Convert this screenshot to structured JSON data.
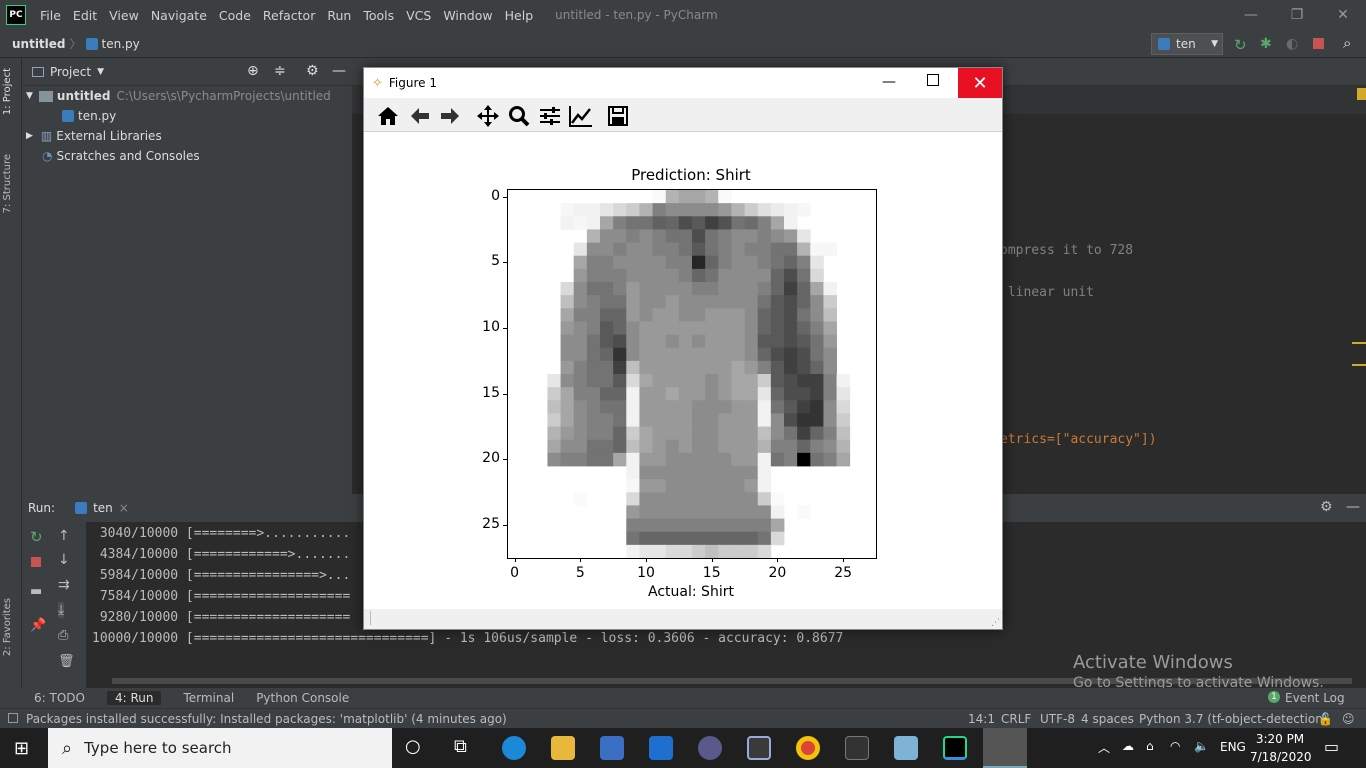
{
  "window": {
    "title": "untitled - ten.py - PyCharm",
    "logo": "PC"
  },
  "menu": [
    "File",
    "Edit",
    "View",
    "Navigate",
    "Code",
    "Refactor",
    "Run",
    "Tools",
    "VCS",
    "Window",
    "Help"
  ],
  "breadcrumb": {
    "project": "untitled",
    "file": "ten.py"
  },
  "run_config": "ten",
  "left_strip": {
    "project_tab": "1: Project",
    "structure_tab": "7: Structure",
    "favorites_tab": "2: Favorites"
  },
  "project_panel": {
    "title": "Project",
    "tree": [
      {
        "label": "untitled",
        "path": "C:\\Users\\s\\PycharmProjects\\untitled"
      },
      {
        "label": "ten.py"
      },
      {
        "label": "External Libraries"
      },
      {
        "label": "Scratches and Consoles"
      }
    ]
  },
  "editor_lines": [
    {
      "text": "ompress it to 728"
    },
    {
      "text": " linear unit"
    },
    {
      "text": "etrics=[\"accuracy\"])"
    }
  ],
  "run_panel": {
    "label": "Run:",
    "tab": "ten",
    "output": [
      " 3040/10000 [========>...........",
      " 4384/10000 [============>.......",
      " 5984/10000 [================>...",
      " 7584/10000 [====================",
      " 9280/10000 [====================",
      "10000/10000 [==============================] - 1s 106us/sample - loss: 0.3606 - accuracy: 0.8677"
    ]
  },
  "bottom_tabs": [
    "6: TODO",
    "4: Run",
    "Terminal",
    "Python Console"
  ],
  "event_log": {
    "badge": "1",
    "label": "Event Log"
  },
  "status": {
    "message": "Packages installed successfully: Installed packages: 'matplotlib' (4 minutes ago)",
    "position": "14:1",
    "line_sep": "CRLF",
    "encoding": "UTF-8",
    "indent": "4 spaces",
    "interpreter": "Python 3.7 (tf-object-detection)"
  },
  "activate": {
    "line1": "Activate Windows",
    "line2": "Go to Settings to activate Windows."
  },
  "taskbar": {
    "search_placeholder": "Type here to search",
    "time": "3:20 PM",
    "date": "7/18/2020",
    "lang": "ENG"
  },
  "figure": {
    "title": "Figure 1",
    "toolbar": [
      "home-icon",
      "back-icon",
      "forward-icon",
      "pan-icon",
      "zoom-icon",
      "configure-icon",
      "edit-axis-icon",
      "save-icon"
    ]
  },
  "chart_data": {
    "type": "heatmap",
    "title": "Prediction: Shirt",
    "xlabel": "Actual: Shirt",
    "ylabel": "",
    "colormap": "gray_r",
    "xticks": [
      0,
      5,
      10,
      15,
      20,
      25
    ],
    "yticks": [
      0,
      5,
      10,
      15,
      20,
      25
    ],
    "xlim": [
      -0.5,
      27.5
    ],
    "ylim": [
      27.5,
      -0.5
    ],
    "values": [
      [
        0,
        0,
        0,
        0,
        0,
        0,
        0,
        0,
        0,
        0,
        0,
        0.02,
        0.3,
        0.35,
        0.35,
        0.3,
        0.02,
        0,
        0,
        0,
        0,
        0,
        0,
        0,
        0,
        0,
        0,
        0
      ],
      [
        0,
        0,
        0,
        0,
        0.03,
        0.05,
        0.05,
        0.1,
        0.15,
        0.2,
        0.3,
        0.5,
        0.45,
        0.45,
        0.45,
        0.45,
        0.4,
        0.3,
        0.2,
        0.12,
        0.08,
        0.05,
        0.03,
        0,
        0,
        0,
        0,
        0
      ],
      [
        0,
        0,
        0,
        0,
        0.05,
        0.03,
        0.05,
        0.35,
        0.5,
        0.55,
        0.55,
        0.62,
        0.6,
        0.7,
        0.65,
        0.75,
        0.68,
        0.55,
        0.58,
        0.5,
        0.35,
        0.05,
        0,
        0,
        0,
        0,
        0,
        0
      ],
      [
        0,
        0,
        0,
        0,
        0,
        0,
        0.3,
        0.45,
        0.45,
        0.5,
        0.45,
        0.5,
        0.55,
        0.55,
        0.7,
        0.55,
        0.5,
        0.45,
        0.45,
        0.5,
        0.45,
        0.4,
        0.1,
        0,
        0,
        0,
        0,
        0
      ],
      [
        0,
        0,
        0,
        0,
        0,
        0.1,
        0.45,
        0.45,
        0.5,
        0.45,
        0.45,
        0.5,
        0.5,
        0.55,
        0.65,
        0.55,
        0.5,
        0.45,
        0.5,
        0.5,
        0.55,
        0.55,
        0.3,
        0.03,
        0.03,
        0,
        0,
        0
      ],
      [
        0,
        0,
        0,
        0,
        0,
        0.35,
        0.5,
        0.5,
        0.45,
        0.45,
        0.45,
        0.45,
        0.5,
        0.5,
        0.85,
        0.6,
        0.5,
        0.45,
        0.45,
        0.5,
        0.55,
        0.6,
        0.5,
        0.1,
        0,
        0,
        0,
        0
      ],
      [
        0,
        0,
        0,
        0,
        0,
        0.4,
        0.5,
        0.5,
        0.5,
        0.45,
        0.45,
        0.45,
        0.45,
        0.5,
        0.6,
        0.55,
        0.45,
        0.45,
        0.45,
        0.45,
        0.6,
        0.7,
        0.55,
        0.15,
        0,
        0,
        0,
        0
      ],
      [
        0,
        0,
        0,
        0,
        0.15,
        0.45,
        0.55,
        0.55,
        0.5,
        0.4,
        0.45,
        0.45,
        0.45,
        0.45,
        0.5,
        0.5,
        0.45,
        0.45,
        0.45,
        0.5,
        0.6,
        0.75,
        0.6,
        0.35,
        0.05,
        0,
        0,
        0
      ],
      [
        0,
        0,
        0,
        0,
        0.25,
        0.45,
        0.5,
        0.55,
        0.55,
        0.4,
        0.45,
        0.45,
        0.4,
        0.45,
        0.45,
        0.45,
        0.45,
        0.45,
        0.45,
        0.55,
        0.65,
        0.7,
        0.6,
        0.45,
        0.2,
        0,
        0,
        0
      ],
      [
        0,
        0,
        0,
        0,
        0.35,
        0.5,
        0.5,
        0.6,
        0.6,
        0.4,
        0.45,
        0.4,
        0.4,
        0.45,
        0.45,
        0.4,
        0.4,
        0.4,
        0.45,
        0.6,
        0.65,
        0.7,
        0.55,
        0.45,
        0.25,
        0,
        0,
        0
      ],
      [
        0,
        0,
        0,
        0,
        0.4,
        0.45,
        0.5,
        0.65,
        0.6,
        0.45,
        0.4,
        0.4,
        0.4,
        0.4,
        0.4,
        0.4,
        0.4,
        0.4,
        0.45,
        0.6,
        0.65,
        0.7,
        0.6,
        0.5,
        0.35,
        0,
        0,
        0
      ],
      [
        0,
        0,
        0,
        0,
        0.45,
        0.45,
        0.55,
        0.65,
        0.7,
        0.45,
        0.4,
        0.4,
        0.45,
        0.4,
        0.45,
        0.4,
        0.4,
        0.4,
        0.45,
        0.65,
        0.65,
        0.7,
        0.65,
        0.55,
        0.4,
        0,
        0,
        0
      ],
      [
        0,
        0,
        0,
        0,
        0.45,
        0.45,
        0.55,
        0.6,
        0.8,
        0.45,
        0.4,
        0.4,
        0.4,
        0.4,
        0.4,
        0.4,
        0.4,
        0.4,
        0.45,
        0.6,
        0.7,
        0.75,
        0.7,
        0.55,
        0.45,
        0,
        0,
        0
      ],
      [
        0,
        0,
        0,
        0,
        0.4,
        0.5,
        0.55,
        0.55,
        0.75,
        0.25,
        0.4,
        0.4,
        0.4,
        0.4,
        0.4,
        0.4,
        0.4,
        0.35,
        0.4,
        0.5,
        0.65,
        0.75,
        0.7,
        0.6,
        0.45,
        0,
        0,
        0
      ],
      [
        0,
        0,
        0,
        0.1,
        0.45,
        0.5,
        0.55,
        0.55,
        0.65,
        0.15,
        0.35,
        0.4,
        0.4,
        0.4,
        0.4,
        0.45,
        0.4,
        0.35,
        0.35,
        0.2,
        0.65,
        0.7,
        0.75,
        0.75,
        0.5,
        0.05,
        0,
        0
      ],
      [
        0,
        0,
        0,
        0.2,
        0.35,
        0.5,
        0.5,
        0.6,
        0.6,
        0.05,
        0.4,
        0.4,
        0.35,
        0.4,
        0.4,
        0.45,
        0.4,
        0.35,
        0.35,
        0.1,
        0.6,
        0.7,
        0.7,
        0.75,
        0.5,
        0.1,
        0,
        0
      ],
      [
        0,
        0,
        0,
        0.25,
        0.35,
        0.45,
        0.5,
        0.55,
        0.55,
        0.05,
        0.4,
        0.4,
        0.4,
        0.4,
        0.45,
        0.45,
        0.45,
        0.4,
        0.4,
        0.05,
        0.55,
        0.65,
        0.75,
        0.8,
        0.45,
        0.15,
        0,
        0
      ],
      [
        0,
        0,
        0,
        0.2,
        0.35,
        0.45,
        0.5,
        0.5,
        0.55,
        0.05,
        0.4,
        0.4,
        0.4,
        0.4,
        0.45,
        0.45,
        0.4,
        0.4,
        0.4,
        0.05,
        0.45,
        0.7,
        0.8,
        0.8,
        0.45,
        0.2,
        0,
        0
      ],
      [
        0,
        0,
        0,
        0.3,
        0.4,
        0.45,
        0.5,
        0.5,
        0.6,
        0.2,
        0.35,
        0.4,
        0.4,
        0.4,
        0.45,
        0.45,
        0.4,
        0.4,
        0.4,
        0.25,
        0.45,
        0.55,
        0.75,
        0.6,
        0.5,
        0.25,
        0,
        0
      ],
      [
        0,
        0,
        0,
        0.35,
        0.45,
        0.45,
        0.55,
        0.55,
        0.6,
        0.25,
        0.35,
        0.4,
        0.45,
        0.4,
        0.45,
        0.45,
        0.4,
        0.4,
        0.4,
        0.3,
        0.5,
        0.5,
        0.6,
        0.5,
        0.45,
        0.3,
        0,
        0
      ],
      [
        0,
        0,
        0,
        0.45,
        0.5,
        0.5,
        0.55,
        0.55,
        0.35,
        0.05,
        0.4,
        0.4,
        0.45,
        0.45,
        0.45,
        0.45,
        0.45,
        0.4,
        0.4,
        0.05,
        0.55,
        0.5,
        1.0,
        0.55,
        0.5,
        0.35,
        0,
        0
      ],
      [
        0,
        0,
        0,
        0,
        0,
        0,
        0,
        0,
        0,
        0.05,
        0.45,
        0.45,
        0.45,
        0.45,
        0.45,
        0.45,
        0.45,
        0.45,
        0.45,
        0.05,
        0,
        0,
        0,
        0,
        0,
        0,
        0,
        0
      ],
      [
        0,
        0,
        0,
        0,
        0,
        0,
        0,
        0,
        0,
        0.03,
        0.4,
        0.4,
        0.45,
        0.45,
        0.45,
        0.45,
        0.45,
        0.45,
        0.4,
        0.05,
        0,
        0,
        0,
        0,
        0,
        0,
        0,
        0
      ],
      [
        0,
        0,
        0,
        0,
        0,
        0.02,
        0,
        0,
        0,
        0.15,
        0.45,
        0.45,
        0.45,
        0.45,
        0.45,
        0.45,
        0.45,
        0.45,
        0.45,
        0.2,
        0.02,
        0,
        0,
        0,
        0,
        0,
        0,
        0
      ],
      [
        0,
        0,
        0,
        0,
        0,
        0,
        0,
        0,
        0,
        0.4,
        0.45,
        0.45,
        0.45,
        0.45,
        0.45,
        0.45,
        0.45,
        0.45,
        0.45,
        0.45,
        0.05,
        0,
        0.02,
        0,
        0,
        0,
        0,
        0
      ],
      [
        0,
        0,
        0,
        0,
        0,
        0,
        0,
        0,
        0,
        0.5,
        0.5,
        0.5,
        0.5,
        0.5,
        0.5,
        0.5,
        0.5,
        0.5,
        0.5,
        0.5,
        0.35,
        0,
        0,
        0,
        0,
        0,
        0,
        0
      ],
      [
        0,
        0,
        0,
        0,
        0,
        0,
        0,
        0,
        0,
        0.55,
        0.6,
        0.6,
        0.6,
        0.6,
        0.6,
        0.6,
        0.6,
        0.6,
        0.6,
        0.55,
        0.15,
        0,
        0,
        0,
        0,
        0,
        0,
        0
      ],
      [
        0,
        0,
        0,
        0,
        0,
        0,
        0,
        0,
        0,
        0.05,
        0.1,
        0.1,
        0.15,
        0.15,
        0.2,
        0.25,
        0.2,
        0.2,
        0.2,
        0.15,
        0,
        0,
        0,
        0,
        0,
        0,
        0,
        0
      ]
    ]
  }
}
